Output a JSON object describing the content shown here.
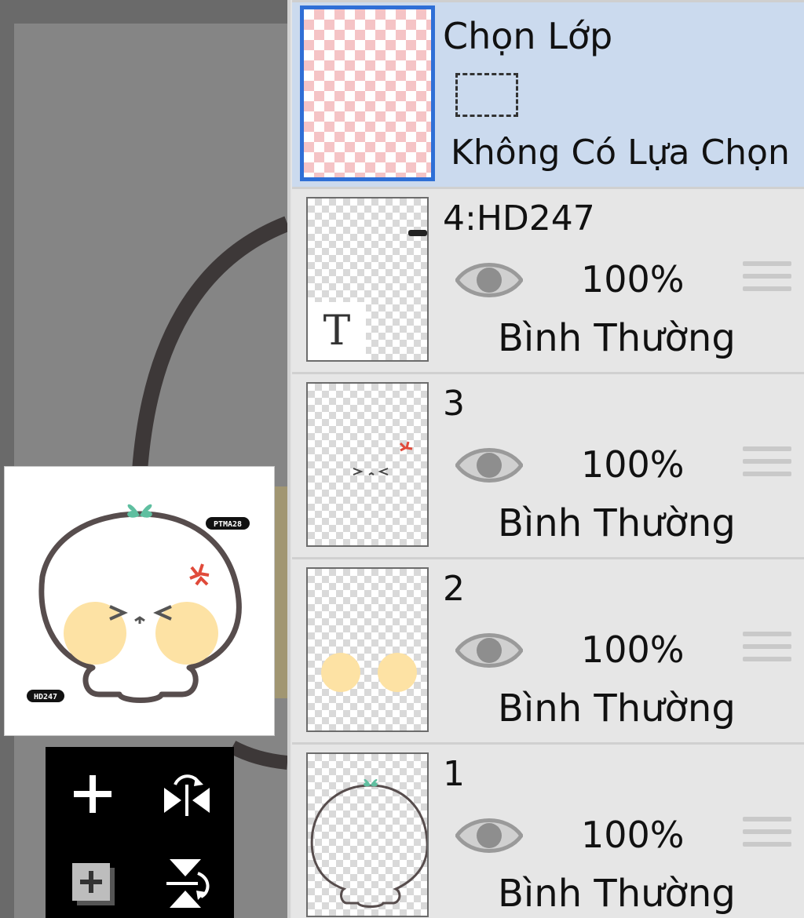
{
  "canvas": {
    "navigator": {
      "watermark_top": "PTMA28",
      "watermark_bottom": "HD247"
    }
  },
  "tools": [
    {
      "icon": "plus-icon"
    },
    {
      "icon": "flip-horizontal-icon"
    },
    {
      "icon": "add-layer-icon"
    },
    {
      "icon": "flip-vertical-icon"
    }
  ],
  "selection_layer": {
    "title": "Chọn Lớp",
    "status": "Không Có Lựa Chọn"
  },
  "layers": [
    {
      "name": "4:HD247",
      "opacity": "100%",
      "blend": "Bình Thường",
      "type": "text",
      "badge": "T"
    },
    {
      "name": "3",
      "opacity": "100%",
      "blend": "Bình Thường",
      "type": "raster"
    },
    {
      "name": "2",
      "opacity": "100%",
      "blend": "Bình Thường",
      "type": "raster"
    },
    {
      "name": "1",
      "opacity": "100%",
      "blend": "Bình Thường",
      "type": "raster"
    }
  ],
  "colors": {
    "selected_row": "#cbdaee",
    "selected_border": "#2f6fd6",
    "outline": "#4e4444",
    "cheek": "#fde2a4",
    "leaf": "#5fbfa0",
    "anger_mark": "#e04a3a"
  }
}
